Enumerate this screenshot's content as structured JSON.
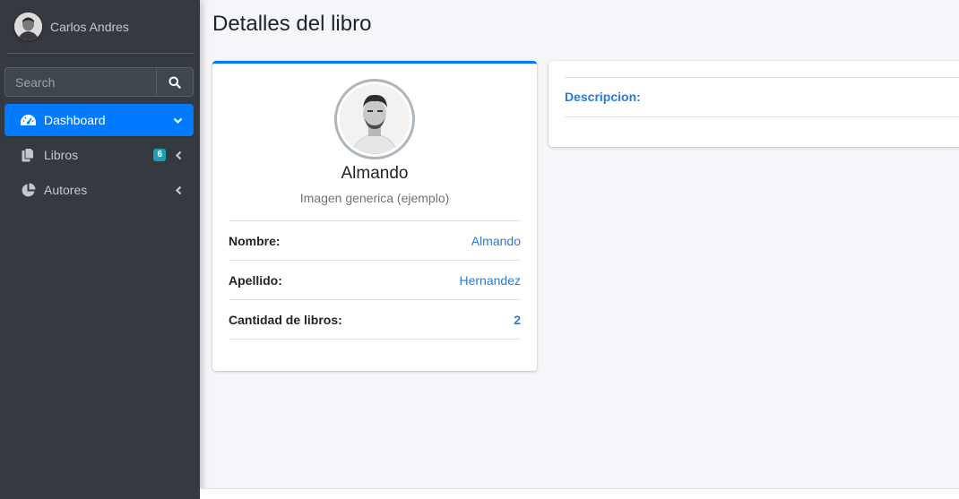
{
  "sidebar": {
    "user_name": "Carlos Andres",
    "search_placeholder": "Search",
    "items": [
      {
        "label": "Dashboard",
        "icon": "tachometer-icon",
        "active": true
      },
      {
        "label": "Libros",
        "icon": "copy-icon",
        "badge": "6"
      },
      {
        "label": "Autores",
        "icon": "pie-chart-icon"
      }
    ]
  },
  "page": {
    "title": "Detalles del libro"
  },
  "profile": {
    "name": "Almando",
    "subtitle": "Imagen generica (ejemplo)",
    "rows": [
      {
        "label": "Nombre:",
        "value": "Almando"
      },
      {
        "label": "Apellido:",
        "value": "Hernandez"
      },
      {
        "label": "Cantidad de libros:",
        "value": "2"
      }
    ]
  },
  "description": {
    "label": "Descripcion:"
  },
  "colors": {
    "primary": "#007bff",
    "sidebar_bg": "#343a40",
    "badge": "#17a2b8",
    "link": "#2a7ad6"
  }
}
